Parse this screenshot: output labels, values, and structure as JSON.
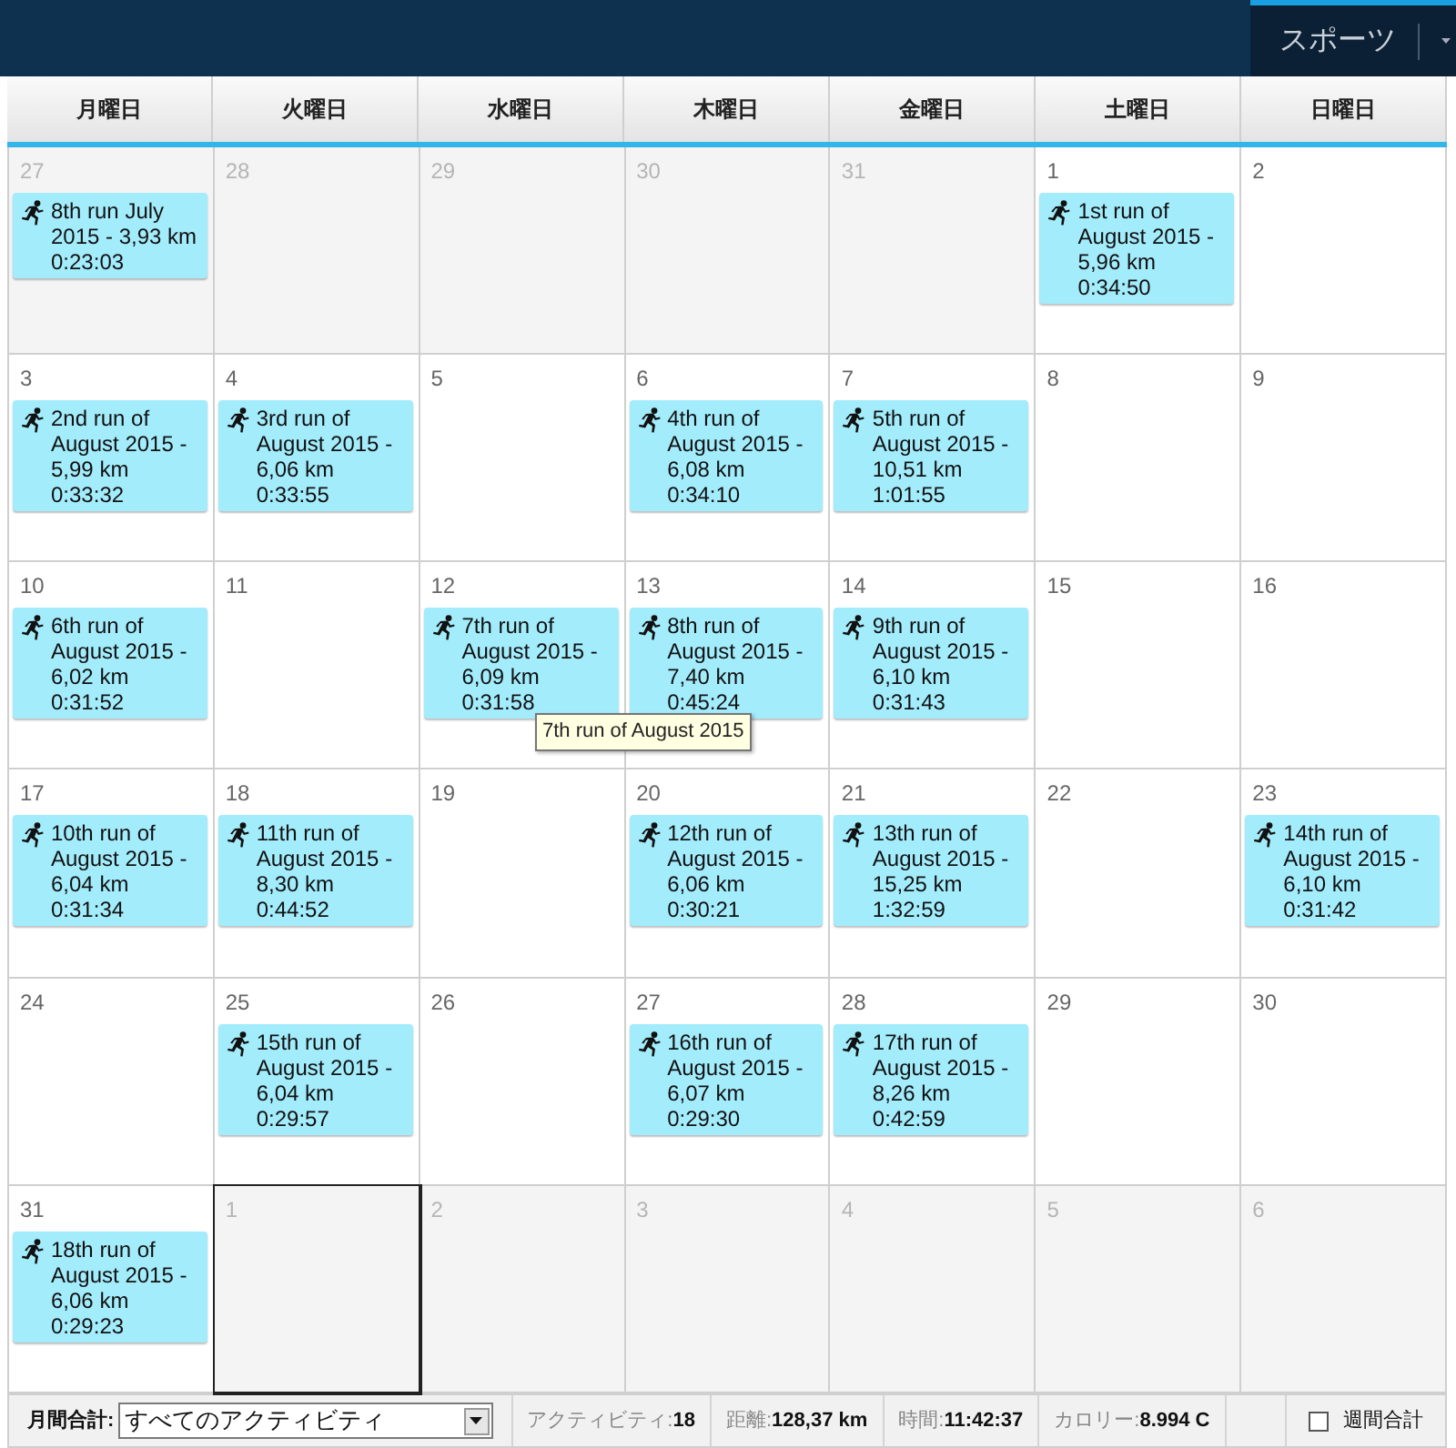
{
  "top_bar": {
    "tab": {
      "label": "スポーツ",
      "selected": true
    }
  },
  "weekdays": [
    "月曜日",
    "火曜日",
    "水曜日",
    "木曜日",
    "金曜日",
    "土曜日",
    "日曜日"
  ],
  "days": [
    {
      "day": "27",
      "other_month": true,
      "selected": false,
      "event": {
        "title": "8th run July 2015 - 3,93 km",
        "time": "0:23:03"
      }
    },
    {
      "day": "28",
      "other_month": true,
      "selected": false
    },
    {
      "day": "29",
      "other_month": true,
      "selected": false
    },
    {
      "day": "30",
      "other_month": true,
      "selected": false
    },
    {
      "day": "31",
      "other_month": true,
      "selected": false
    },
    {
      "day": "1",
      "other_month": false,
      "selected": false,
      "event": {
        "title": "1st run of August 2015 - 5,96 km",
        "time": "0:34:50"
      }
    },
    {
      "day": "2",
      "other_month": false,
      "selected": false
    },
    {
      "day": "3",
      "other_month": false,
      "selected": false,
      "event": {
        "title": "2nd run of August 2015 - 5,99 km",
        "time": "0:33:32"
      }
    },
    {
      "day": "4",
      "other_month": false,
      "selected": false,
      "event": {
        "title": "3rd run of August 2015 - 6,06 km",
        "time": "0:33:55"
      }
    },
    {
      "day": "5",
      "other_month": false,
      "selected": false
    },
    {
      "day": "6",
      "other_month": false,
      "selected": false,
      "event": {
        "title": "4th run of August 2015 - 6,08 km",
        "time": "0:34:10"
      }
    },
    {
      "day": "7",
      "other_month": false,
      "selected": false,
      "event": {
        "title": "5th run of August 2015 - 10,51 km",
        "time": "1:01:55"
      }
    },
    {
      "day": "8",
      "other_month": false,
      "selected": false
    },
    {
      "day": "9",
      "other_month": false,
      "selected": false
    },
    {
      "day": "10",
      "other_month": false,
      "selected": false,
      "event": {
        "title": "6th run of August 2015 - 6,02 km",
        "time": "0:31:52"
      }
    },
    {
      "day": "11",
      "other_month": false,
      "selected": false
    },
    {
      "day": "12",
      "other_month": false,
      "selected": false,
      "event": {
        "title": "7th run of August 2015 - 6,09 km",
        "time": "0:31:58"
      }
    },
    {
      "day": "13",
      "other_month": false,
      "selected": false,
      "event": {
        "title": "8th run of August 2015 - 7,40 km",
        "time": "0:45:24"
      }
    },
    {
      "day": "14",
      "other_month": false,
      "selected": false,
      "event": {
        "title": "9th run of August 2015 - 6,10 km",
        "time": "0:31:43"
      }
    },
    {
      "day": "15",
      "other_month": false,
      "selected": false
    },
    {
      "day": "16",
      "other_month": false,
      "selected": false
    },
    {
      "day": "17",
      "other_month": false,
      "selected": false,
      "event": {
        "title": "10th run of August 2015 - 6,04 km",
        "time": "0:31:34"
      }
    },
    {
      "day": "18",
      "other_month": false,
      "selected": false,
      "event": {
        "title": "11th run of August 2015 - 8,30 km",
        "time": "0:44:52"
      }
    },
    {
      "day": "19",
      "other_month": false,
      "selected": false
    },
    {
      "day": "20",
      "other_month": false,
      "selected": false,
      "event": {
        "title": "12th run of August 2015 - 6,06 km",
        "time": "0:30:21"
      }
    },
    {
      "day": "21",
      "other_month": false,
      "selected": false,
      "event": {
        "title": "13th run of August 2015 - 15,25 km",
        "time": "1:32:59"
      }
    },
    {
      "day": "22",
      "other_month": false,
      "selected": false
    },
    {
      "day": "23",
      "other_month": false,
      "selected": false,
      "event": {
        "title": "14th run of August 2015 - 6,10 km",
        "time": "0:31:42"
      }
    },
    {
      "day": "24",
      "other_month": false,
      "selected": false
    },
    {
      "day": "25",
      "other_month": false,
      "selected": false,
      "event": {
        "title": "15th run of August 2015 - 6,04 km",
        "time": "0:29:57"
      }
    },
    {
      "day": "26",
      "other_month": false,
      "selected": false
    },
    {
      "day": "27",
      "other_month": false,
      "selected": false,
      "event": {
        "title": "16th run of August 2015 - 6,07 km",
        "time": "0:29:30"
      }
    },
    {
      "day": "28",
      "other_month": false,
      "selected": false,
      "event": {
        "title": "17th run of August 2015 - 8,26 km",
        "time": "0:42:59"
      }
    },
    {
      "day": "29",
      "other_month": false,
      "selected": false
    },
    {
      "day": "30",
      "other_month": false,
      "selected": false
    },
    {
      "day": "31",
      "other_month": false,
      "selected": false,
      "event": {
        "title": "18th run of August 2015 - 6,06 km",
        "time": "0:29:23"
      }
    },
    {
      "day": "1",
      "other_month": true,
      "selected": true
    },
    {
      "day": "2",
      "other_month": true,
      "selected": false
    },
    {
      "day": "3",
      "other_month": true,
      "selected": false
    },
    {
      "day": "4",
      "other_month": true,
      "selected": false
    },
    {
      "day": "5",
      "other_month": true,
      "selected": false
    },
    {
      "day": "6",
      "other_month": true,
      "selected": false
    }
  ],
  "tooltip": {
    "text": "7th run of August 2015"
  },
  "footer": {
    "label": "月間合計:",
    "filter": {
      "value": "すべてのアクティビティ"
    },
    "stats": [
      {
        "label": "アクティビティ:",
        "value": "18"
      },
      {
        "label": "距離:",
        "value": "128,37 km"
      },
      {
        "label": "時間:",
        "value": "11:42:37"
      },
      {
        "label": "カロリー:",
        "value": "8.994 C"
      }
    ],
    "weekly_total": {
      "label": "週間合計",
      "checked": false
    }
  }
}
